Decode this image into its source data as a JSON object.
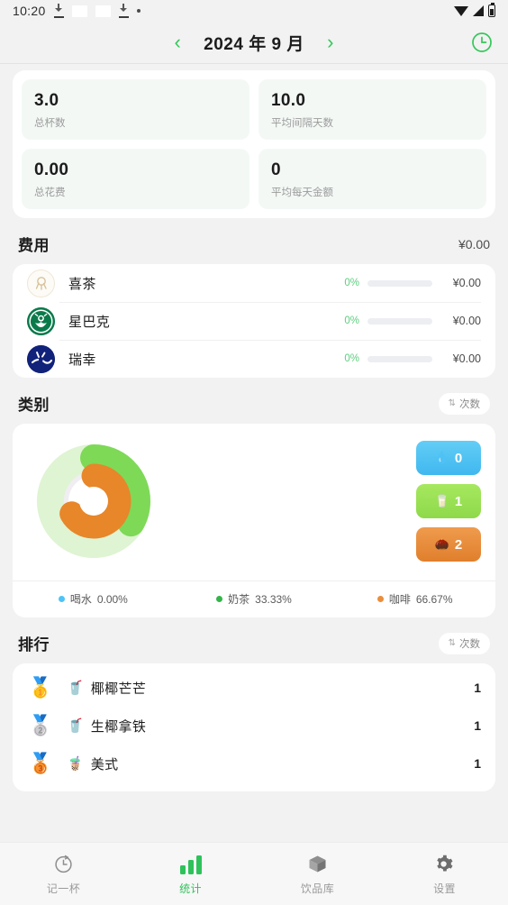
{
  "statusbar": {
    "time": "10:20",
    "icons": [
      "download-icon",
      "notification-placeholder",
      "notification-placeholder",
      "download-icon",
      "dot-icon"
    ],
    "right_icons": [
      "wifi-icon",
      "signal-icon",
      "battery-icon"
    ]
  },
  "header": {
    "prev_label": "‹",
    "month": "2024 年 9 月",
    "next_label": "›",
    "history_icon": "clock-icon"
  },
  "stats": {
    "tiles": [
      {
        "value": "3.0",
        "label": "总杯数"
      },
      {
        "value": "10.0",
        "label": "平均间隔天数"
      },
      {
        "value": "0.00",
        "label": "总花费"
      },
      {
        "value": "0",
        "label": "平均每天金额"
      }
    ]
  },
  "expense": {
    "title": "费用",
    "total": "¥0.00",
    "rows": [
      {
        "brand": "喜茶",
        "logo": "heytea-logo",
        "percent": "0%",
        "amount": "¥0.00",
        "bar_fill": 0
      },
      {
        "brand": "星巴克",
        "logo": "starbucks-logo",
        "percent": "0%",
        "amount": "¥0.00",
        "bar_fill": 0
      },
      {
        "brand": "瑞幸",
        "logo": "luckin-logo",
        "percent": "0%",
        "amount": "¥0.00",
        "bar_fill": 0
      }
    ]
  },
  "category": {
    "title": "类别",
    "toggle_label": "次数",
    "toggle_icon": "swap-icon",
    "chips": [
      {
        "icon": "water-drop-icon",
        "value": "0",
        "color": "#4fc3f7"
      },
      {
        "icon": "cup-icon",
        "value": "1",
        "color": "#9ede53"
      },
      {
        "icon": "coffee-bean-icon",
        "value": "2",
        "color": "#ea8e3c"
      }
    ],
    "legend": [
      {
        "name": "喝水",
        "percent": "0.00%",
        "color": "#4fc3f7"
      },
      {
        "name": "奶茶",
        "percent": "33.33%",
        "color": "#34b54a"
      },
      {
        "name": "咖啡",
        "percent": "66.67%",
        "color": "#ea8e3c"
      }
    ]
  },
  "chart_data": {
    "type": "pie",
    "title": "类别",
    "categories": [
      "喝水",
      "奶茶",
      "咖啡"
    ],
    "values": [
      0,
      1,
      2
    ],
    "percentages": [
      0.0,
      33.33,
      66.67
    ],
    "colors": [
      "#4fc3f7",
      "#7ed957",
      "#e8862a"
    ],
    "rings": [
      {
        "name": "奶茶",
        "percent": 33.33,
        "color": "#7ed957",
        "track": "#dff4d2",
        "radius": "outer"
      },
      {
        "name": "咖啡",
        "percent": 66.67,
        "color": "#e8862a",
        "track": "#ffffff",
        "radius": "inner"
      }
    ],
    "legend_position": "bottom",
    "grid": false
  },
  "ranking": {
    "title": "排行",
    "toggle_label": "次数",
    "toggle_icon": "swap-icon",
    "rows": [
      {
        "medal": "🥇",
        "emoji": "🥤",
        "name": "椰椰芒芒",
        "count": "1"
      },
      {
        "medal": "🥈",
        "emoji": "🥤",
        "name": "生椰拿铁",
        "count": "1"
      },
      {
        "medal": "🥉",
        "emoji": "🧋",
        "name": "美式",
        "count": "1"
      }
    ]
  },
  "tabbar": {
    "items": [
      {
        "label": "记一杯",
        "icon": "record-clock-icon",
        "active": false
      },
      {
        "label": "统计",
        "icon": "bar-chart-icon",
        "active": true
      },
      {
        "label": "饮品库",
        "icon": "box-icon",
        "active": false
      },
      {
        "label": "设置",
        "icon": "gear-icon",
        "active": false
      }
    ]
  },
  "colors": {
    "accent": "#2fc25b",
    "page_bg": "#f2f2f2",
    "card_bg": "#ffffff"
  }
}
